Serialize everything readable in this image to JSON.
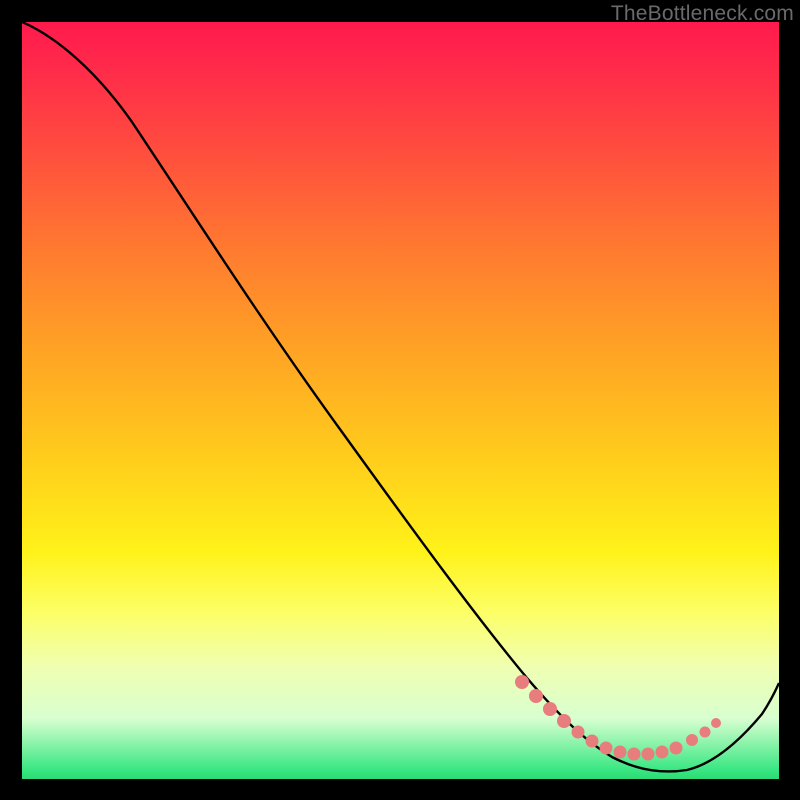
{
  "watermark": "TheBottleneck.com",
  "chart_data": {
    "type": "line",
    "title": "",
    "xlabel": "",
    "ylabel": "",
    "xlim": [
      0,
      100
    ],
    "ylim": [
      0,
      100
    ],
    "series": [
      {
        "name": "curve",
        "color": "#000000",
        "x": [
          0,
          6,
          12,
          20,
          30,
          40,
          50,
          60,
          68,
          72,
          76,
          80,
          84,
          88,
          92,
          96,
          100
        ],
        "y": [
          100,
          97,
          92,
          83,
          70,
          57,
          44,
          31,
          20,
          14,
          9,
          5,
          3,
          2,
          3,
          8,
          16
        ]
      }
    ],
    "markers": {
      "name": "highlight-dots",
      "color": "#e77d7d",
      "x": [
        68,
        70,
        72,
        74,
        76,
        78,
        80,
        82,
        84,
        86,
        88,
        90,
        92
      ],
      "y": [
        6.2,
        5.4,
        4.8,
        4.4,
        4.0,
        3.7,
        3.5,
        3.4,
        3.4,
        3.5,
        3.9,
        4.6,
        5.6
      ]
    }
  }
}
